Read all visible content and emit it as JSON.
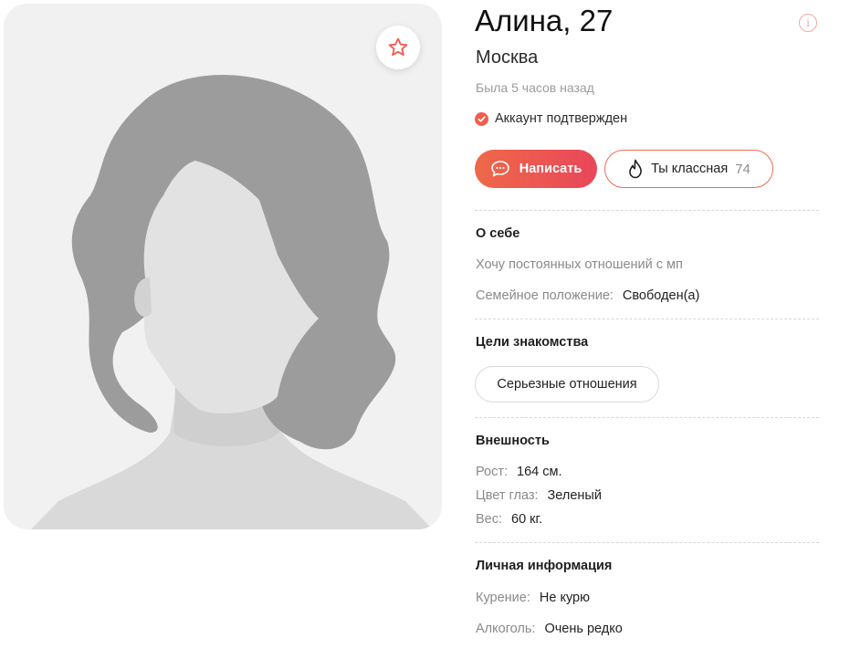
{
  "profile": {
    "title": "Алина, 27",
    "city": "Москва",
    "last_seen": "Была 5 часов назад",
    "verified": "Аккаунт подтвержден"
  },
  "icons": {
    "favorite": "star-icon",
    "info": "info-icon",
    "message": "chat-bubble-icon",
    "like": "flame-icon",
    "verified": "check-circle-icon"
  },
  "colors": {
    "accent": "#ee5c4d",
    "accent_end": "#e9475a"
  },
  "actions": {
    "write_label": "Написать",
    "like_label": "Ты классная",
    "like_count": "74"
  },
  "about": {
    "title": "О себе",
    "text": "Хочу постоянных отношений с мп",
    "marital_label": "Семейное положение:",
    "marital_value": "Свободен(а)"
  },
  "goals": {
    "title": "Цели знакомства",
    "items": [
      "Серьезные отношения"
    ]
  },
  "appearance": {
    "title": "Внешность",
    "height_label": "Рост:",
    "height_value": "164 см.",
    "eyes_label": "Цвет глаз:",
    "eyes_value": "Зеленый",
    "weight_label": "Вес:",
    "weight_value": "60 кг."
  },
  "personal": {
    "title": "Личная информация",
    "smoking_label": "Курение:",
    "smoking_value": "Не курю",
    "alcohol_label": "Алкоголь:",
    "alcohol_value": "Очень редко"
  }
}
